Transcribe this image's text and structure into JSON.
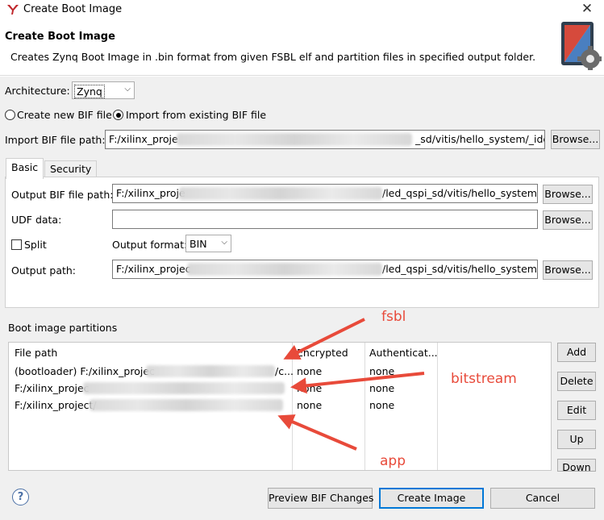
{
  "window": {
    "title": "Create Boot Image",
    "close_glyph": "✕"
  },
  "header": {
    "title": "Create Boot Image",
    "description": "Creates Zynq Boot Image in .bin format from given FSBL elf and partition files in specified output folder."
  },
  "architecture": {
    "label": "Architecture:",
    "value": "Zynq"
  },
  "mode": {
    "create_new_label": "Create new BIF file",
    "import_label": "Import from existing BIF file",
    "selected": "import"
  },
  "import_bif": {
    "label": "Import BIF file path:",
    "value_prefix": "F:/xilinx_proje",
    "value_suffix": "_sd/vitis/hello_system/_ide/",
    "browse_label": "Browse..."
  },
  "tabs": [
    {
      "label": "Basic",
      "active": true
    },
    {
      "label": "Security",
      "active": false
    }
  ],
  "basic": {
    "output_bif": {
      "label": "Output BIF file path:",
      "value_prefix": "F:/xilinx_proje",
      "value_suffix": "/led_qspi_sd/vitis/hello_system/_i",
      "browse_label": "Browse..."
    },
    "udf": {
      "label": "UDF data:",
      "value": "",
      "browse_label": "Browse..."
    },
    "split": {
      "label": "Split",
      "checked": false
    },
    "output_format": {
      "label": "Output format:",
      "value": "BIN"
    },
    "output_path": {
      "label": "Output path:",
      "value_prefix": "F:/xilinx_projec",
      "value_suffix": "/led_qspi_sd/vitis/hello_system/_i",
      "browse_label": "Browse..."
    }
  },
  "partitions": {
    "section_label": "Boot image partitions",
    "columns": [
      "File path",
      "Encrypted",
      "Authenticat..."
    ],
    "rows": [
      {
        "file_prefix": "(bootloader) F:/xilinx_projec",
        "file_suffix": "/c...",
        "encrypted": "none",
        "authenticated": "none"
      },
      {
        "file_prefix": "F:/xilinx_projec",
        "file_suffix": "",
        "encrypted": "none",
        "authenticated": "none"
      },
      {
        "file_prefix": "F:/xilinx_project/",
        "file_suffix": "",
        "encrypted": "none",
        "authenticated": "none"
      }
    ],
    "buttons": {
      "add": "Add",
      "delete": "Delete",
      "edit": "Edit",
      "up": "Up",
      "down": "Down"
    }
  },
  "annotations": {
    "fsbl": "fsbl",
    "bitstream": "bitstream",
    "app": "app"
  },
  "footer": {
    "help_glyph": "?",
    "preview_label": "Preview BIF Changes",
    "create_label": "Create Image",
    "cancel_label": "Cancel"
  },
  "colors": {
    "annotation_red": "#e84a3a",
    "focus_blue": "#0078d7"
  }
}
